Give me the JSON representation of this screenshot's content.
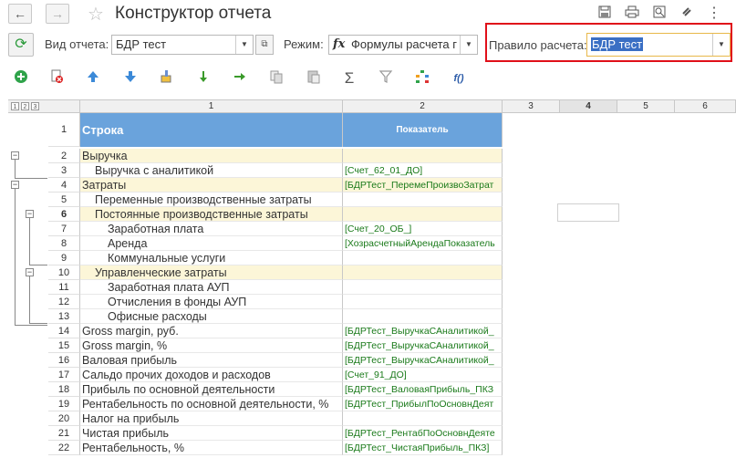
{
  "window": {
    "title": "Конструктор отчета",
    "back_glyph": "←",
    "forward_glyph": "→",
    "icons": [
      "save-icon",
      "print-icon",
      "preview-icon",
      "search-icon",
      "link-icon",
      "more-icon"
    ]
  },
  "params": {
    "report_type_label": "Вид отчета:",
    "report_type_value": "БДР тест",
    "mode_label": "Режим:",
    "mode_value": "Формулы расчета г",
    "rule_label": "Правило расчета:",
    "rule_value": "БДР тест"
  },
  "toolbar": {
    "icons": [
      "add-icon",
      "delete-icon",
      "move-up-icon",
      "move-down-icon",
      "clear-icon",
      "arrow-down-icon",
      "arrow-right-icon",
      "copy-icon",
      "paste-icon",
      "sum-icon",
      "filter-icon",
      "tree-icon",
      "formula-icon"
    ],
    "sum_glyph": "Σ",
    "formula_glyph": "f()"
  },
  "grid": {
    "levels": [
      "1",
      "2",
      "3"
    ],
    "columns": [
      "1",
      "2",
      "3",
      "4",
      "5",
      "6"
    ],
    "header_row": {
      "num": "1",
      "col1": "Строка",
      "col2": "Показатель"
    },
    "rows": [
      {
        "num": "2",
        "text": "Выручка",
        "indent": 0,
        "ref": "",
        "hl": true
      },
      {
        "num": "3",
        "text": "Выручка с аналитикой",
        "indent": 1,
        "ref": "[Счет_62_01_ДО]",
        "hl": false
      },
      {
        "num": "4",
        "text": "Затраты",
        "indent": 0,
        "ref": "[БДРТест_ПеремеПроизвоЗатрат",
        "hl": true
      },
      {
        "num": "5",
        "text": "Переменные производственные затраты",
        "indent": 1,
        "ref": "",
        "hl": false
      },
      {
        "num": "6",
        "text": "Постоянные производственные затраты",
        "indent": 1,
        "ref": "",
        "hl": true
      },
      {
        "num": "7",
        "text": "Заработная плата",
        "indent": 2,
        "ref": "[Счет_20_ОБ_]",
        "hl": false
      },
      {
        "num": "8",
        "text": "Аренда",
        "indent": 2,
        "ref": "[ХозрасчетныйАрендаПоказатель",
        "hl": false
      },
      {
        "num": "9",
        "text": "Коммунальные услуги",
        "indent": 2,
        "ref": "",
        "hl": false
      },
      {
        "num": "10",
        "text": "Управленческие затраты",
        "indent": 1,
        "ref": "",
        "hl": true
      },
      {
        "num": "11",
        "text": "Заработная плата АУП",
        "indent": 2,
        "ref": "",
        "hl": false
      },
      {
        "num": "12",
        "text": "Отчисления в фонды АУП",
        "indent": 2,
        "ref": "",
        "hl": false
      },
      {
        "num": "13",
        "text": "Офисные расходы",
        "indent": 2,
        "ref": "",
        "hl": false
      },
      {
        "num": "14",
        "text": "Gross margin, руб.",
        "indent": 0,
        "ref": "[БДРТест_ВыручкаСАналитикой_",
        "hl": false
      },
      {
        "num": "15",
        "text": "Gross margin, %",
        "indent": 0,
        "ref": "[БДРТест_ВыручкаСАналитикой_",
        "hl": false
      },
      {
        "num": "16",
        "text": "Валовая прибыль",
        "indent": 0,
        "ref": "[БДРТест_ВыручкаСАналитикой_",
        "hl": false
      },
      {
        "num": "17",
        "text": "Сальдо прочих доходов и расходов",
        "indent": 0,
        "ref": "[Счет_91_ДО]",
        "hl": false
      },
      {
        "num": "18",
        "text": "Прибыль по основной деятельности",
        "indent": 0,
        "ref": "[БДРТест_ВаловаяПрибыль_ПКЗ",
        "hl": false
      },
      {
        "num": "19",
        "text": "Рентабельность по основной деятельности, %",
        "indent": 0,
        "ref": "[БДРТест_ПрибылПоОсновнДеят",
        "hl": false
      },
      {
        "num": "20",
        "text": "Налог на прибыль",
        "indent": 0,
        "ref": "",
        "hl": false
      },
      {
        "num": "21",
        "text": "Чистая прибыль",
        "indent": 0,
        "ref": "[БДРТест_РентабПоОсновнДеяте",
        "hl": false
      },
      {
        "num": "22",
        "text": "Рентабельность, %",
        "indent": 0,
        "ref": "[БДРТест_ЧистаяПрибыль_ПКЗ]",
        "hl": false
      }
    ]
  }
}
